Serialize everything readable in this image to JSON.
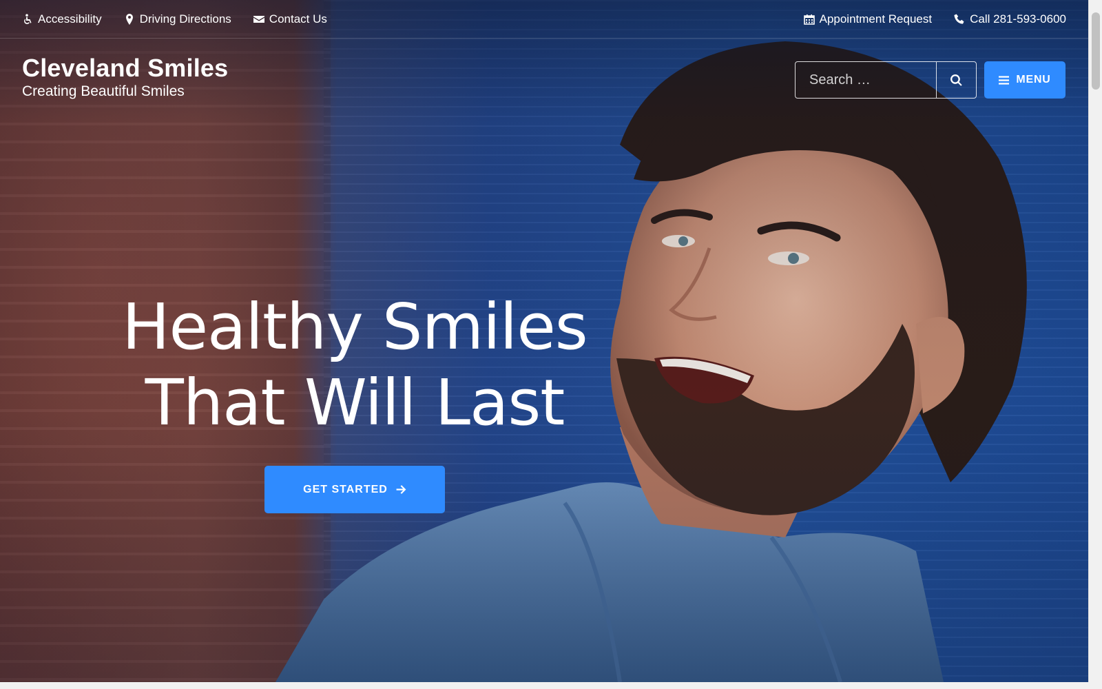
{
  "topbar": {
    "left": [
      {
        "label": "Accessibility",
        "icon": "wheelchair-icon"
      },
      {
        "label": "Driving Directions",
        "icon": "map-marker-icon"
      },
      {
        "label": "Contact Us",
        "icon": "envelope-icon"
      }
    ],
    "right": [
      {
        "label": "Appointment Request",
        "icon": "calendar-icon"
      },
      {
        "label": "Call 281-593-0600",
        "icon": "phone-icon"
      }
    ]
  },
  "brand": {
    "name": "Cleveland Smiles",
    "tagline": "Creating Beautiful Smiles"
  },
  "search": {
    "placeholder": "Search …",
    "value": "",
    "icon": "search-icon"
  },
  "menu": {
    "label": "MENU",
    "icon": "hamburger-icon"
  },
  "hero": {
    "headline_line1": "Healthy Smiles",
    "headline_line2": "That Will Last",
    "cta_label": "GET STARTED",
    "cta_icon": "arrow-right-icon"
  },
  "colors": {
    "accent": "#2f8bff",
    "text": "#ffffff"
  }
}
